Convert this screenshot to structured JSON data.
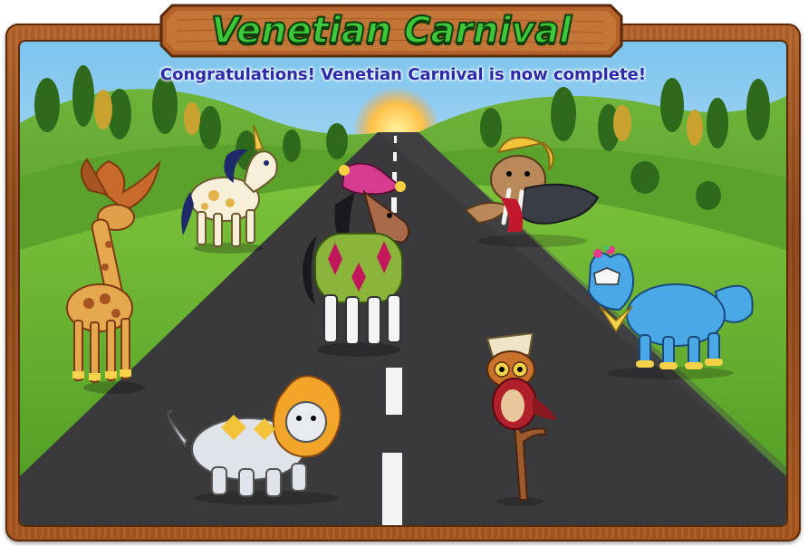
{
  "header": {
    "title": "Venetian Carnival",
    "subtitle": "Congratulations! Venetian Carnival is now complete!"
  },
  "colors": {
    "title_green": "#3cc83a",
    "subtitle_blue": "#2b2aa8",
    "wood": "#a9571f",
    "road": "#3a3a3c",
    "grass": "#5da32b"
  },
  "animals": [
    {
      "name": "giraffe",
      "icon": "carnival-giraffe"
    },
    {
      "name": "unicorn",
      "icon": "carnival-unicorn"
    },
    {
      "name": "jester-horse",
      "icon": "jester-horse"
    },
    {
      "name": "walrus",
      "icon": "carnival-walrus"
    },
    {
      "name": "wolf",
      "icon": "carnival-wolf"
    },
    {
      "name": "lion",
      "icon": "carnival-lion"
    },
    {
      "name": "owl",
      "icon": "carnival-owl"
    }
  ]
}
